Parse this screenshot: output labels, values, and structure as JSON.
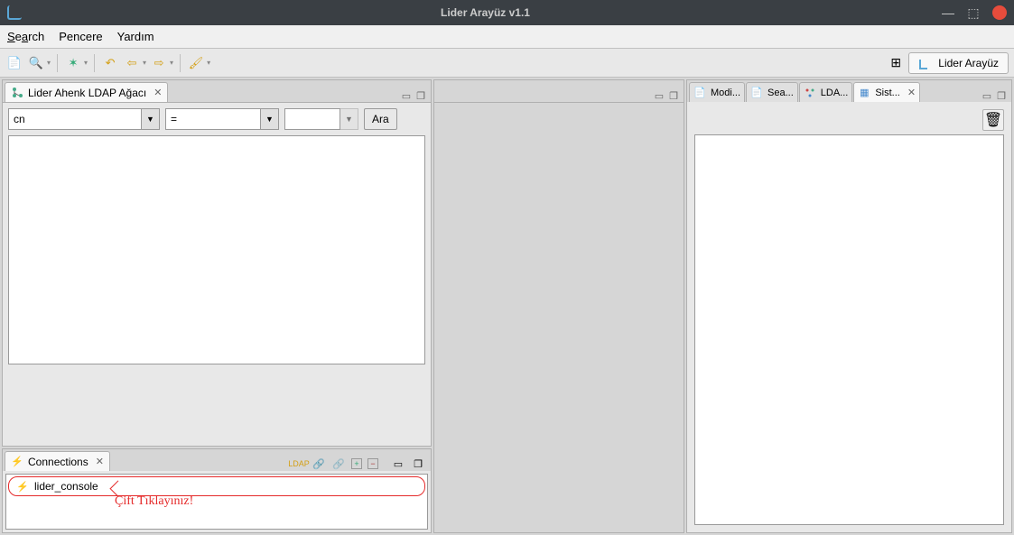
{
  "window": {
    "title": "Lider Arayüz v1.1"
  },
  "menu": {
    "search": "Search",
    "pencere": "Pencere",
    "yardim": "Yardım"
  },
  "perspective": {
    "label": "Lider Arayüz"
  },
  "views": {
    "ldap_tree": {
      "tab_label": "Lider Ahenk LDAP Ağacı",
      "search": {
        "attr_value": "cn",
        "op_value": "=",
        "val_value": "",
        "button": "Ara"
      }
    },
    "connections": {
      "tab_label": "Connections",
      "item": "lider_console",
      "annotation": "Çift Tıklayınız!"
    },
    "right_tabs": {
      "t1": "Modi...",
      "t2": "Sea...",
      "t3": "LDA...",
      "t4": "Sist..."
    }
  }
}
